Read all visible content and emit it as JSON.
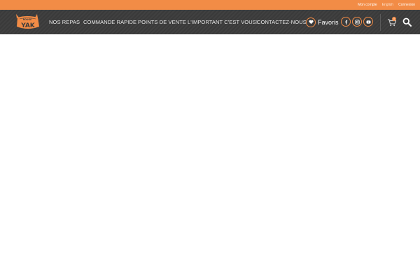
{
  "topbar": {
    "links": [
      {
        "label": "Mon compte"
      },
      {
        "label": "English"
      },
      {
        "label": "Connexion"
      }
    ],
    "color": "#f28c46"
  },
  "header": {
    "logo": {
      "top_text": "ROUGE",
      "main_text": "YAK"
    },
    "menu": [
      {
        "label": "NOS REPAS"
      },
      {
        "label": "COMMANDE RAPIDE"
      },
      {
        "label": "POINTS DE VENTE"
      },
      {
        "label": "L'IMPORTANT C'EST VOUS!"
      },
      {
        "label": "CONTACTEZ-NOUS"
      }
    ],
    "favorites": {
      "label": "Favoris",
      "icon": "heart-icon"
    },
    "social": [
      {
        "icon": "facebook-icon"
      },
      {
        "icon": "instagram-icon"
      },
      {
        "icon": "youtube-icon"
      }
    ],
    "cart": {
      "icon": "cart-icon",
      "count": "0"
    },
    "search": {
      "icon": "search-icon"
    },
    "background": "#3c3c3c",
    "accent": "#f28c46"
  }
}
